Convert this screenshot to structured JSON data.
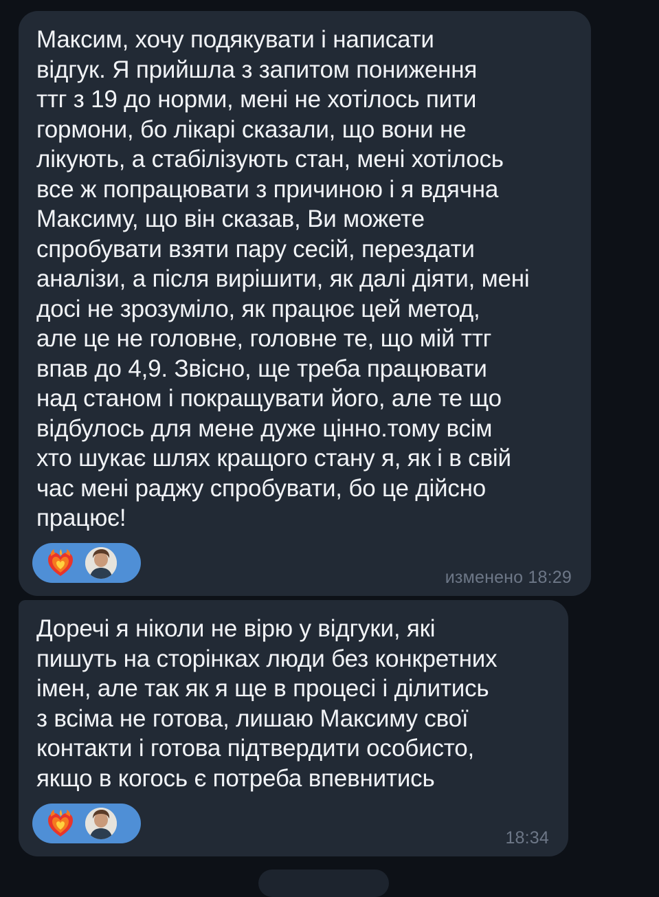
{
  "messages": [
    {
      "text": "Максим, хочу подякувати і написати\nвідгук. Я прийшла з запитом пониження\nттг з 19 до норми, мені не хотілось пити\nгормони, бо лікарі сказали, що вони не\nлікують, а стабілізують стан, мені хотілось\nвсе ж попрацювати з причиною і я вдячна\nМаксиму, що він сказав, Ви можете\nспробувати взяти пару сесій, перездати\nаналізи, а після вирішити, як далі діяти, мені\nдосі не зрозуміло, як працює цей метод,\nале це не головне, головне те, що мій ттг\nвпав до 4,9. Звісно, ще треба працювати\nнад станом і покращувати його, але те що\nвідбулось для мене дуже цінно.тому всім\nхто шукає шлях кращого стану я, як і в свій\nчас мені раджу спробувати, бо це дійсно\nпрацює!",
      "time": "изменено 18:29",
      "reaction_icon": "heart-on-fire-icon"
    },
    {
      "text": "Доречі я ніколи не вірю у відгуки, які\nпишуть на сторінках люди без конкретних\nімен, але так як я ще в процесі і ділитись\nз всіма не готова, лишаю Максиму свої\nконтакти і готова підтвердити особисто,\nякщо в когось є потреба впевнитись",
      "time": "18:34",
      "reaction_icon": "heart-on-fire-icon"
    }
  ],
  "colors": {
    "background": "#0d1117",
    "bubble": "#222a35",
    "text": "#f1f3f6",
    "timestamp": "#6d7787",
    "reaction_pill": "#4f8fd6"
  }
}
